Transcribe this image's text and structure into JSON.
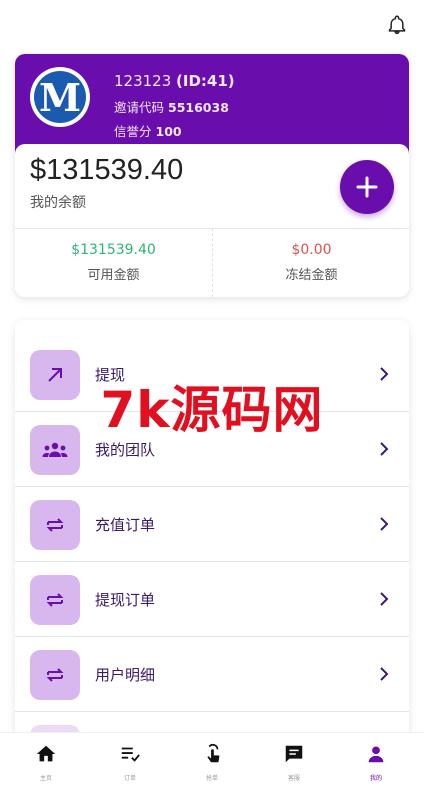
{
  "colors": {
    "primary": "#6a0dad",
    "icon_bg": "#d8b7ee",
    "available": "#2bb673",
    "frozen": "#e05050",
    "watermark": "#e01020"
  },
  "profile": {
    "avatar_letter": "M",
    "username": "123123",
    "id_text": "(ID:41)",
    "invite_label": "邀请代码",
    "invite_code": "5516038",
    "credit_label": "信誉分",
    "credit_score": "100"
  },
  "balance": {
    "amount": "$131539.40",
    "label": "我的余额",
    "available_amount": "$131539.40",
    "available_label": "可用金额",
    "frozen_amount": "$0.00",
    "frozen_label": "冻结金额"
  },
  "menu": {
    "items": [
      {
        "label": "提现",
        "icon": "arrow-up-right-icon"
      },
      {
        "label": "我的团队",
        "icon": "team-icon"
      },
      {
        "label": "充值订单",
        "icon": "swap-icon"
      },
      {
        "label": "提现订单",
        "icon": "swap-icon"
      },
      {
        "label": "用户明细",
        "icon": "swap-icon"
      }
    ]
  },
  "watermark": "7k源码网",
  "nav": {
    "items": [
      {
        "label": "主页",
        "icon": "home-icon"
      },
      {
        "label": "订单",
        "icon": "order-list-icon"
      },
      {
        "label": "抢单",
        "icon": "grab-order-icon"
      },
      {
        "label": "客服",
        "icon": "chat-icon"
      },
      {
        "label": "我的",
        "icon": "person-icon",
        "active": true
      }
    ]
  }
}
